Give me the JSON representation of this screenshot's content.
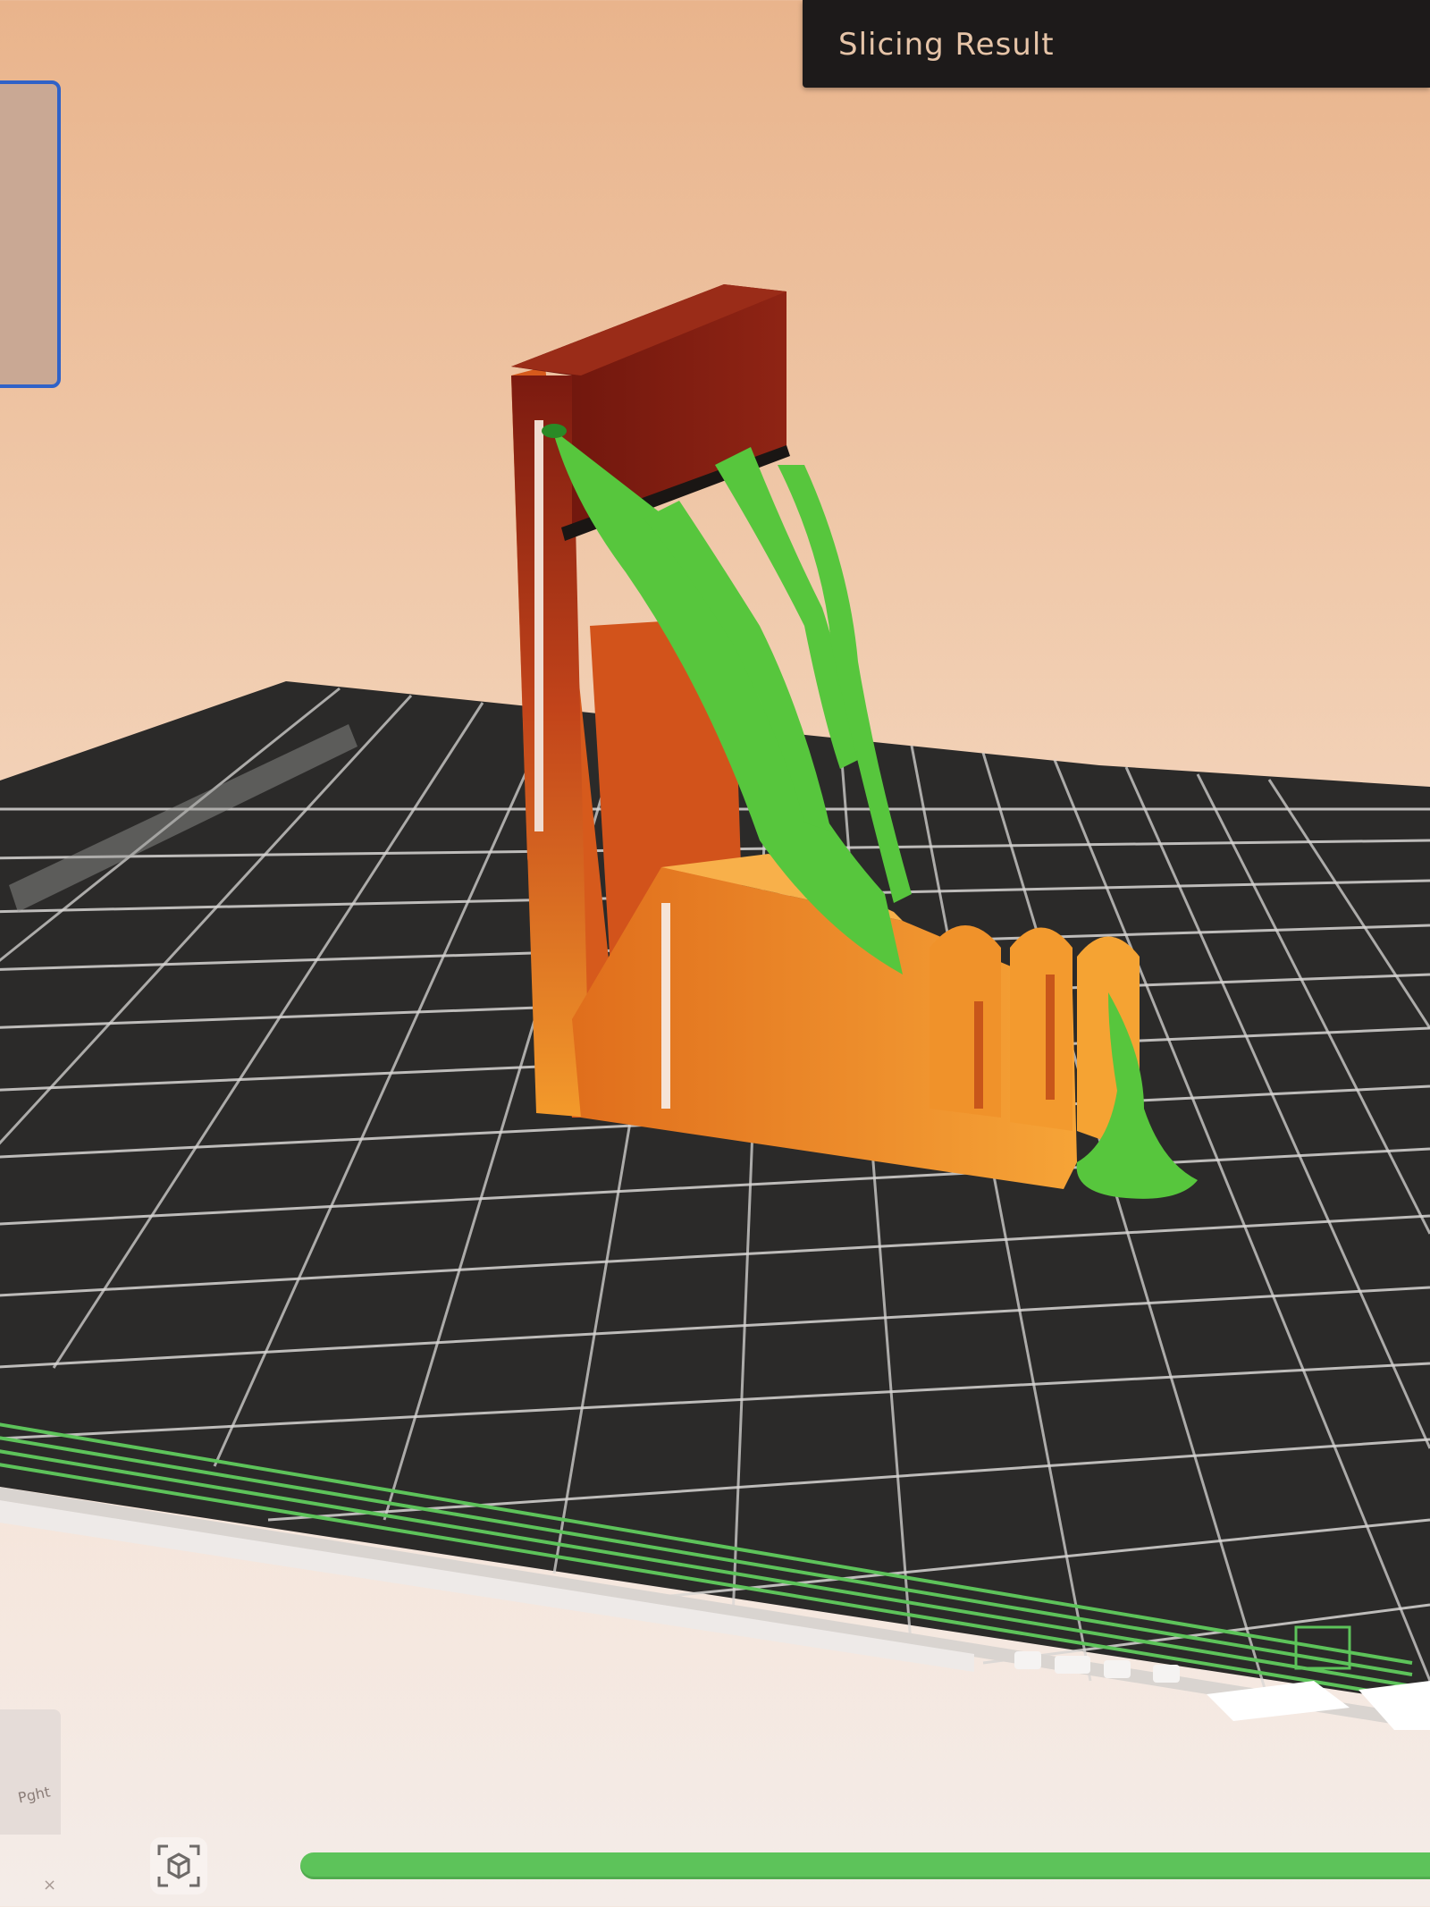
{
  "header": {
    "title": "Slicing Result"
  },
  "bottom": {
    "corner_label": "Pght",
    "corner_close": "×"
  },
  "icons": {
    "view_cube": "cube-view-icon"
  },
  "colors": {
    "accent_green": "#5dc35a",
    "model_orange": "#f08a24",
    "model_dark": "#7b1a10",
    "support_green": "#57c63d",
    "plate_dark": "#2b2a29",
    "selection_blue": "#2f62c8"
  }
}
